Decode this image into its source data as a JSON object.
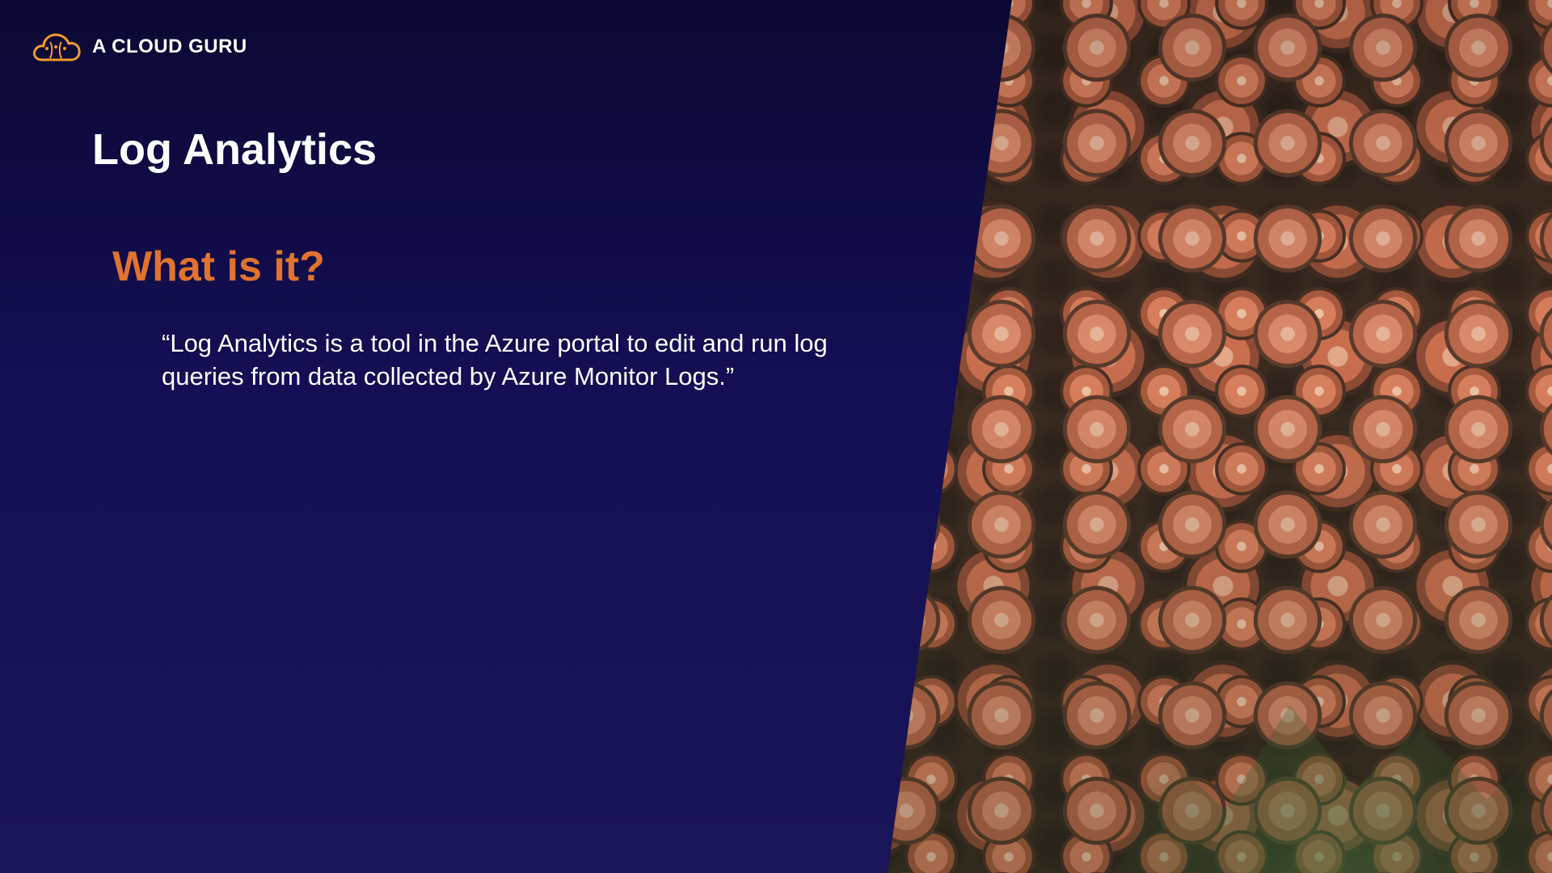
{
  "brand": {
    "name": "A CLOUD GURU",
    "logo_icon": "cloud-logo-icon",
    "accent_color": "#f29a2e"
  },
  "slide": {
    "title": "Log Analytics",
    "heading": "What is it?",
    "heading_color": "#e0732f",
    "quote_lines": [
      "“Log Analytics is a tool in the Azure portal to edit and run log",
      "queries from data collected by Azure Monitor Logs.”"
    ],
    "background_color": "#140f55",
    "image_subject": "stacked-cut-logs-photo"
  }
}
